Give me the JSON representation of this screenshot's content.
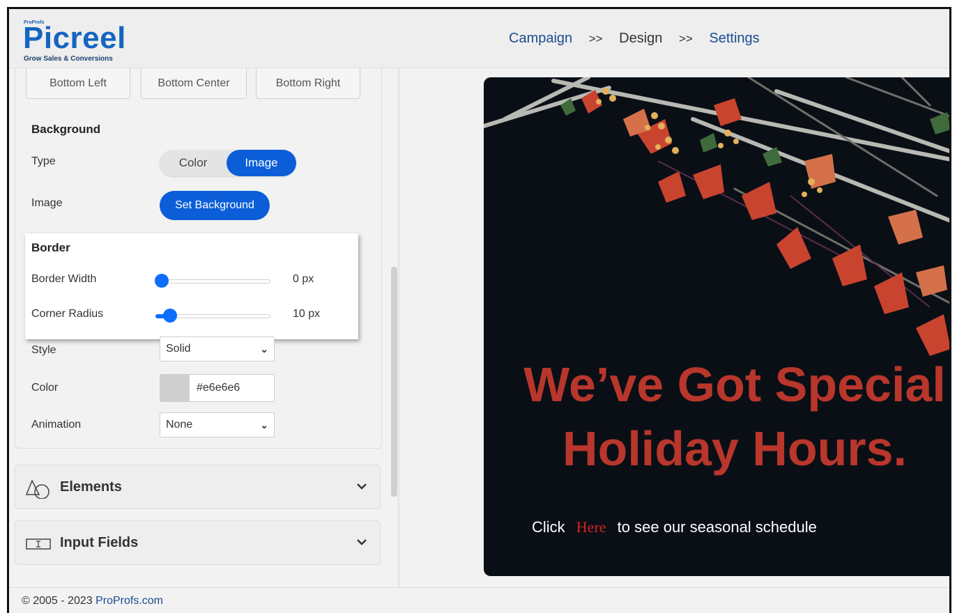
{
  "brand": {
    "small": "ProProfs",
    "name": "Picreel",
    "tagline": "Grow Sales & Conversions"
  },
  "breadcrumb": {
    "items": [
      "Campaign",
      "Design",
      "Settings"
    ],
    "separator": ">>",
    "current_index": 1
  },
  "position_buttons": [
    "Bottom Left",
    "Bottom Center",
    "Bottom Right"
  ],
  "background": {
    "title": "Background",
    "type_label": "Type",
    "type_options": [
      "Color",
      "Image"
    ],
    "type_selected": "Image",
    "image_label": "Image",
    "set_button": "Set Background"
  },
  "border": {
    "title": "Border",
    "width_label": "Border Width",
    "width_value": "0 px",
    "width_fraction": 0.0,
    "radius_label": "Corner Radius",
    "radius_value": "10 px",
    "radius_fraction": 0.08,
    "style_label": "Style",
    "style_value": "Solid",
    "color_label": "Color",
    "color_value": "#e6e6e6",
    "animation_label": "Animation",
    "animation_value": "None"
  },
  "accordions": [
    {
      "label": "Elements",
      "icon": "shapes-icon"
    },
    {
      "label": "Input Fields",
      "icon": "text-field-icon"
    }
  ],
  "footer": {
    "copyright": "© 2005 - 2023 ",
    "link": "ProProfs.com"
  },
  "preview": {
    "headline_line1": "We’ve Got Special",
    "headline_line2": "Holiday Hours.",
    "cta_prefix": "Click",
    "cta_link": "Here",
    "cta_suffix": "to see our seasonal schedule"
  },
  "colors": {
    "accent": "#0b5ed7",
    "headline": "#b8362b",
    "preview_bg": "#0a0f16",
    "link_red": "#d3231c"
  }
}
